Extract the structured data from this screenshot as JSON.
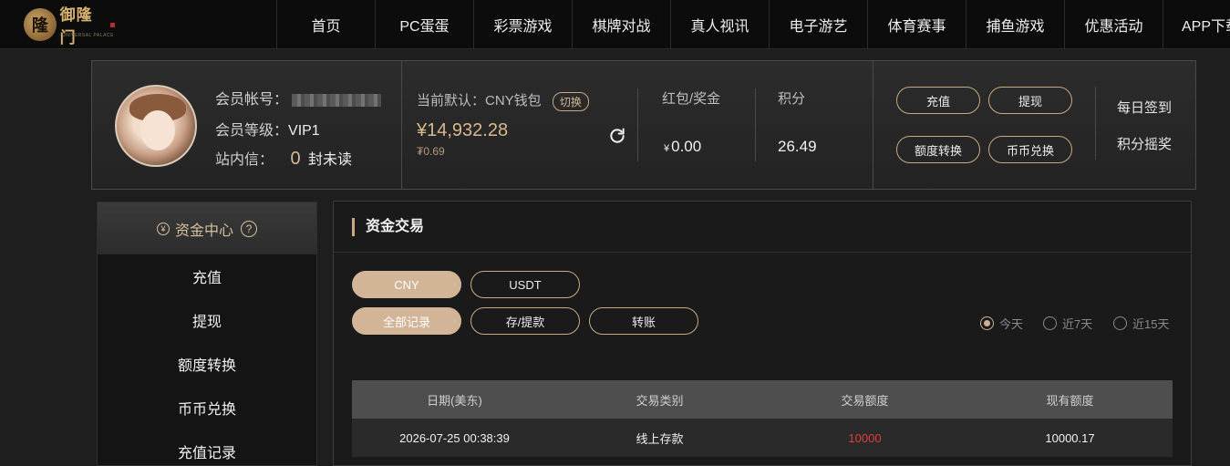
{
  "brand": {
    "logo_text": "御隆门",
    "logo_mark": "隆",
    "logo_sub": "UNIVERSAL PALACE"
  },
  "nav": {
    "items": [
      "首页",
      "PC蛋蛋",
      "彩票游戏",
      "棋牌对战",
      "真人视讯",
      "电子游艺",
      "体育赛事",
      "捕鱼游戏",
      "优惠活动",
      "APP下载"
    ]
  },
  "user": {
    "account_label": "会员帐号：",
    "level_label": "会员等级：",
    "level_value": "VIP1",
    "inbox_label": "站内信：",
    "unread_count": "0",
    "unread_label": "封未读"
  },
  "wallet": {
    "label": "当前默认：CNY钱包",
    "switch_label": "切换",
    "amount": "¥14,932.28",
    "sub_amount": "₮0.69"
  },
  "stats": {
    "bonus_label": "红包/奖金",
    "bonus_currency": "¥",
    "bonus_value": "0.00",
    "points_label": "积分",
    "points_value": "26.49"
  },
  "actions": {
    "deposit": "充值",
    "withdraw": "提现",
    "quota_transfer": "额度转换",
    "coin_exchange": "币币兑换",
    "daily_checkin": "每日签到",
    "points_lottery": "积分摇奖"
  },
  "sidebar": {
    "title": "资金中心",
    "help": "?",
    "yen": "¥",
    "items": [
      {
        "label": "充值"
      },
      {
        "label": "提现"
      },
      {
        "label": "额度转换"
      },
      {
        "label": "币币兑换"
      },
      {
        "label": "充值记录"
      }
    ]
  },
  "main": {
    "title": "资金交易",
    "currency_tabs": [
      {
        "label": "CNY"
      },
      {
        "label": "USDT"
      }
    ],
    "record_tabs": [
      {
        "label": "全部记录"
      },
      {
        "label": "存/提款"
      },
      {
        "label": "转账"
      }
    ],
    "date_filters": [
      {
        "label": "今天"
      },
      {
        "label": "近7天"
      },
      {
        "label": "近15天"
      }
    ],
    "table": {
      "headers": [
        "日期(美东)",
        "交易类别",
        "交易额度",
        "现有额度"
      ],
      "rows": [
        {
          "date": "2026-07-25 00:38:39",
          "type": "线上存款",
          "amount": "10000",
          "balance": "10000.17"
        }
      ]
    }
  },
  "colors": {
    "accent": "#c8a983",
    "amount_red": "#e23c3c",
    "gold_text": "#d9b88e"
  }
}
